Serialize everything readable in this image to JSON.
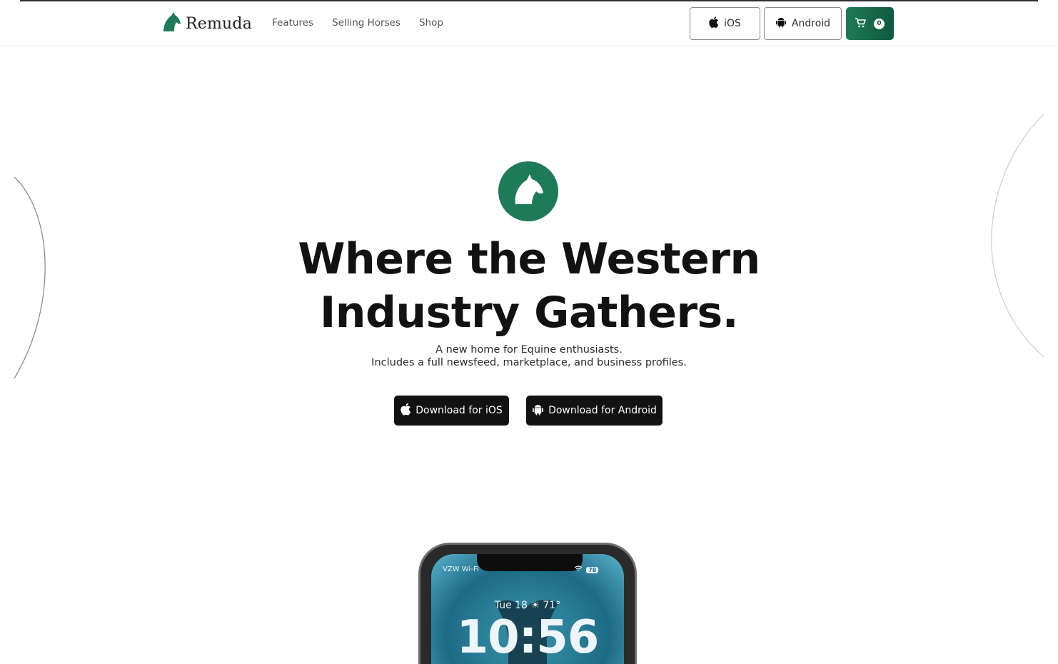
{
  "brand": {
    "name": "Remuda",
    "color": "#1e7a57"
  },
  "nav": {
    "links": [
      "Features",
      "Selling Horses",
      "Shop"
    ]
  },
  "header_buttons": {
    "ios_label": "iOS",
    "android_label": "Android",
    "cart_count": "0"
  },
  "hero": {
    "title_line1": "Where the Western",
    "title_line2": "Industry Gathers.",
    "subtitle_line1": "A new home for Equine enthusiasts.",
    "subtitle_line2": "Includes a full newsfeed, marketplace, and business profiles.",
    "download_ios": "Download for iOS",
    "download_android": "Download for Android"
  },
  "phone": {
    "carrier": "VZW Wi-Fi",
    "battery": "78",
    "date_weather": "Tue 18 ☀ 71°",
    "time": "10:56"
  },
  "icons": [
    "horse-head-icon",
    "apple-icon",
    "android-icon",
    "cart-icon",
    "wifi-icon",
    "battery-icon"
  ]
}
